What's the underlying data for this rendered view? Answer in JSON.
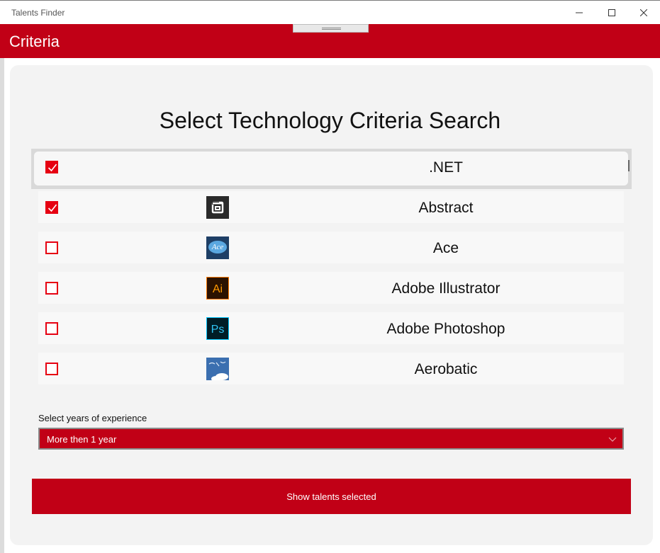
{
  "window": {
    "title": "Talents Finder"
  },
  "header": {
    "title": "Criteria"
  },
  "main": {
    "heading": "Select Technology Criteria Search",
    "technologies": [
      {
        "label": ".NET",
        "checked": true,
        "icon": "none",
        "selected": true
      },
      {
        "label": "Abstract",
        "checked": true,
        "icon": "abstract-logo"
      },
      {
        "label": "Ace",
        "checked": false,
        "icon": "ace-logo",
        "logo_text": "Ace"
      },
      {
        "label": "Adobe Illustrator",
        "checked": false,
        "icon": "adobe-illustrator-logo",
        "logo_text": "Ai"
      },
      {
        "label": "Adobe Photoshop",
        "checked": false,
        "icon": "adobe-photoshop-logo",
        "logo_text": "Ps"
      },
      {
        "label": "Aerobatic",
        "checked": false,
        "icon": "aerobatic-logo"
      }
    ],
    "experience": {
      "label": "Select years of experience",
      "selected": "More then 1 year"
    },
    "show_button": "Show talents selected"
  },
  "colors": {
    "accent": "#c10016",
    "checkbox": "#e60012",
    "card": "#f3f3f3"
  }
}
